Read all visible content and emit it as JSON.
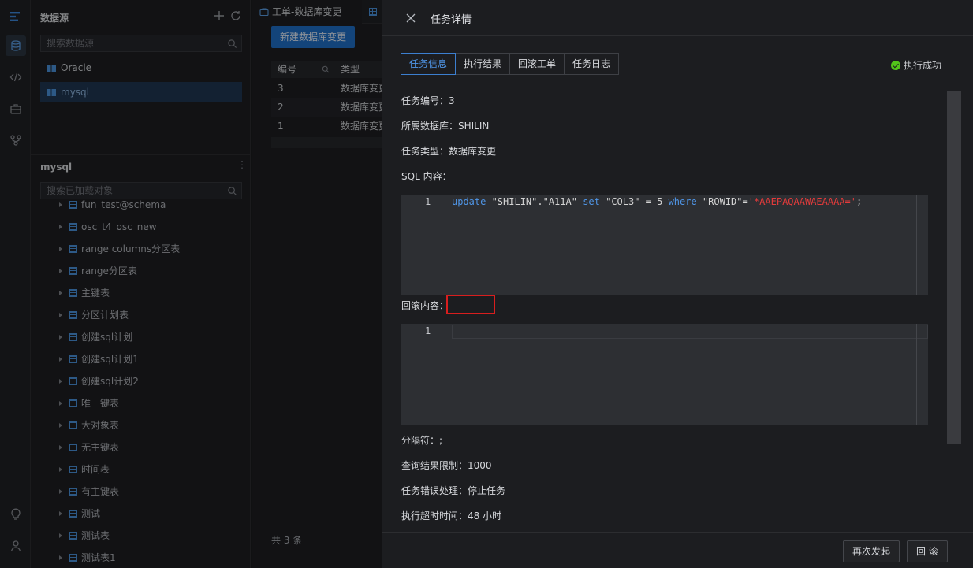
{
  "sidebar": {
    "datasource_title": "数据源",
    "datasource_search_placeholder": "搜索数据源",
    "datasources": [
      {
        "label": "Oracle"
      },
      {
        "label": "mysql"
      }
    ],
    "object_panel_title": "mysql",
    "object_search_placeholder": "搜索已加载对象",
    "tables": [
      "fun_test@schema",
      "osc_t4_osc_new_",
      "range columns分区表",
      "range分区表",
      "主键表",
      "分区计划表",
      "创建sql计划",
      "创建sql计划1",
      "创建sql计划2",
      "唯一键表",
      "大对象表",
      "无主键表",
      "时间表",
      "有主键表",
      "测试",
      "测试表",
      "测试表1"
    ]
  },
  "work_order": {
    "tab_label": "工单-数据库变更",
    "new_button": "新建数据库变更",
    "columns": {
      "id": "编号",
      "type": "类型"
    },
    "rows": [
      {
        "id": "3",
        "type": "数据库变更"
      },
      {
        "id": "2",
        "type": "数据库变更"
      },
      {
        "id": "1",
        "type": "数据库变更"
      }
    ],
    "total": "共 3 条"
  },
  "drawer": {
    "title": "任务详情",
    "tabs": [
      "任务信息",
      "执行结果",
      "回滚工单",
      "任务日志"
    ],
    "status": "执行成功",
    "fields": {
      "task_id": "任务编号：3",
      "database": "所属数据库：SHILIN",
      "task_type": "任务类型：数据库变更",
      "sql_label": "SQL 内容：",
      "rollback_label": "回滚内容：",
      "delimiter": "分隔符：;",
      "query_limit": "查询结果限制：1000",
      "error_handling": "任务错误处理：停止任务",
      "timeout": "执行超时时间：48 小时"
    },
    "sql_editor": {
      "line_number": "1",
      "tokens": {
        "t1": "update",
        "t2": " \"SHILIN\".\"A11A\" ",
        "t3": "set",
        "t4": " \"COL3\" = 5 ",
        "t5": "where",
        "t6": " \"ROWID\"=",
        "t7": "'*AAEPAQAAWAEAAAA='",
        "t8": ";"
      }
    },
    "rollback_editor": {
      "line_number": "1"
    },
    "footer": {
      "reinitiate": "再次发起",
      "rollback": "回 滚"
    }
  },
  "colors": {
    "accent": "#1f6fc5",
    "success": "#52c41a",
    "highlight_border": "#d81e1e"
  }
}
